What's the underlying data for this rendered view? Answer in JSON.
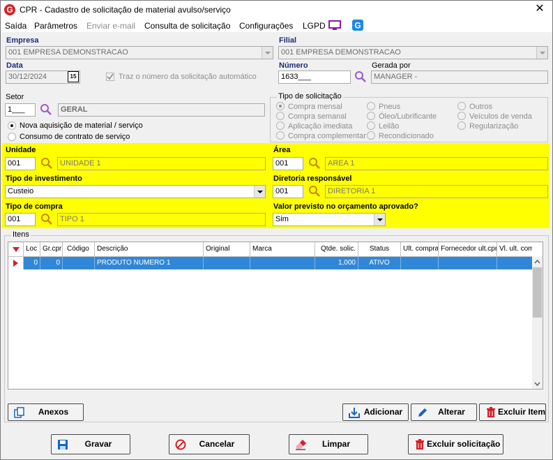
{
  "window": {
    "title": "CPR - Cadastro de solicitação de material avulso/serviço",
    "close": "✕"
  },
  "menu": {
    "saida": "Saída",
    "parametros": "Parâmetros",
    "enviar_email": "Enviar e-mail",
    "consulta": "Consulta de solicitação",
    "configuracoes": "Configurações",
    "lgpd": "LGPD"
  },
  "empresa": {
    "label": "Empresa",
    "value": "001 EMPRESA DEMONSTRACAO"
  },
  "filial": {
    "label": "Filial",
    "value": "001 EMPRESA DEMONSTRACAO"
  },
  "data": {
    "label": "Data",
    "value": "30/12/2024",
    "calendar": "15"
  },
  "auto_number": {
    "label": "Traz o número da solicitação automático",
    "checked": true
  },
  "numero": {
    "label": "Número",
    "value": "1633___"
  },
  "gerada_por": {
    "label": "Gerada por",
    "value": "MANAGER -"
  },
  "setor": {
    "label": "Setor",
    "code": "1___",
    "name": "GERAL"
  },
  "aquisicao": {
    "nova": "Nova aquisição de material / serviço",
    "consumo": "Consumo de contrato de serviço",
    "selected": "nova"
  },
  "tipo_solicitacao": {
    "label": "Tipo de solicitação",
    "options": [
      "Compra mensal",
      "Compra semanal",
      "Aplicação imediata",
      "Compra complementar",
      "Pneus",
      "Óleo/Lubrificante",
      "Leilão",
      "Recondicionado",
      "Outros",
      "Veículos de venda",
      "Regularização"
    ],
    "selected": "Compra mensal"
  },
  "unidade": {
    "label": "Unidade",
    "code": "001",
    "name": "UNIDADE 1"
  },
  "area": {
    "label": "Área",
    "code": "001",
    "name": "AREA 1"
  },
  "tipo_investimento": {
    "label": "Tipo de investimento",
    "value": "Custeio"
  },
  "diretoria": {
    "label": "Diretoria responsável",
    "code": "001",
    "name": "DIRETORIA 1"
  },
  "tipo_compra": {
    "label": "Tipo de compra",
    "code": "001",
    "name": "TIPO 1"
  },
  "valor_previsto": {
    "label": "Valor previsto no orçamento aprovado?",
    "value": "Sim"
  },
  "itens": {
    "label": "Itens",
    "columns": [
      "Loc",
      "Gr.cpr",
      "Código",
      "Descrição",
      "Original",
      "Marca",
      "Qtde. solic.",
      "Status",
      "Ult. compra",
      "Fornecedor ult.cpr",
      "Vl. ult. com"
    ],
    "rows": [
      [
        "0",
        "0",
        "",
        "PRODUTO NUMERO 1",
        "",
        "",
        "1,000",
        "ATIVO",
        "",
        "",
        ""
      ]
    ]
  },
  "buttons": {
    "anexos": "Anexos",
    "adicionar": "Adicionar",
    "alterar": "Alterar",
    "excluir_item": "Excluir Item",
    "gravar": "Gravar",
    "cancelar": "Cancelar",
    "limpar": "Limpar",
    "excluir_solicitacao": "Excluir solicitação"
  },
  "colors": {
    "accent": "#1c2d7a",
    "highlight": "#ffff00",
    "selection": "#3087d8",
    "brand": "#d32027",
    "lgpd": "#8a1aa8"
  }
}
